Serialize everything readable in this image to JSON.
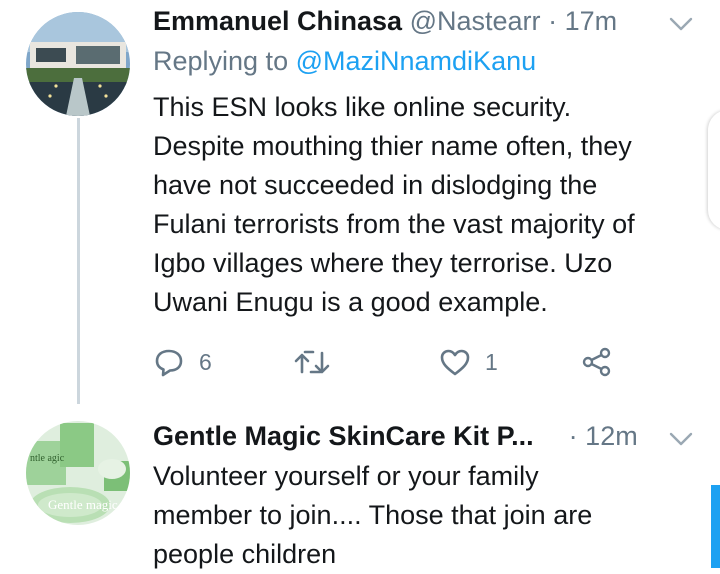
{
  "tweets": [
    {
      "name": "Emmanuel Chinasa",
      "handle": "@Nastearr",
      "separator": "·",
      "time": "17m",
      "replying_prefix": "Replying to",
      "replying_to": "@MaziNnamdiKanu",
      "text": "This ESN looks like online security.\nDespite mouthing thier name often, they\nhave not succeeded in dislodging the\nFulani terrorists from the vast majority of\nIgbo villages where they terrorise. Uzo\nUwani Enugu is a good example.",
      "replies": "6",
      "likes": "1",
      "icons": [
        "reply-icon",
        "retweet-icon",
        "like-icon",
        "share-icon",
        "chevron-down-icon"
      ]
    },
    {
      "name": "Gentle Magic SkinCare Kit P...",
      "separator": "·",
      "time": "12m",
      "text": "Volunteer yourself or your family\nmember to join.... Those that join are\npeople children",
      "avatar_text_1": "Gentle magic",
      "avatar_text_2": "ntle agic"
    }
  ],
  "colors": {
    "accent": "#1da1f2",
    "muted": "#657786",
    "text": "#14171a",
    "thread_line": "#ccd6dd"
  }
}
